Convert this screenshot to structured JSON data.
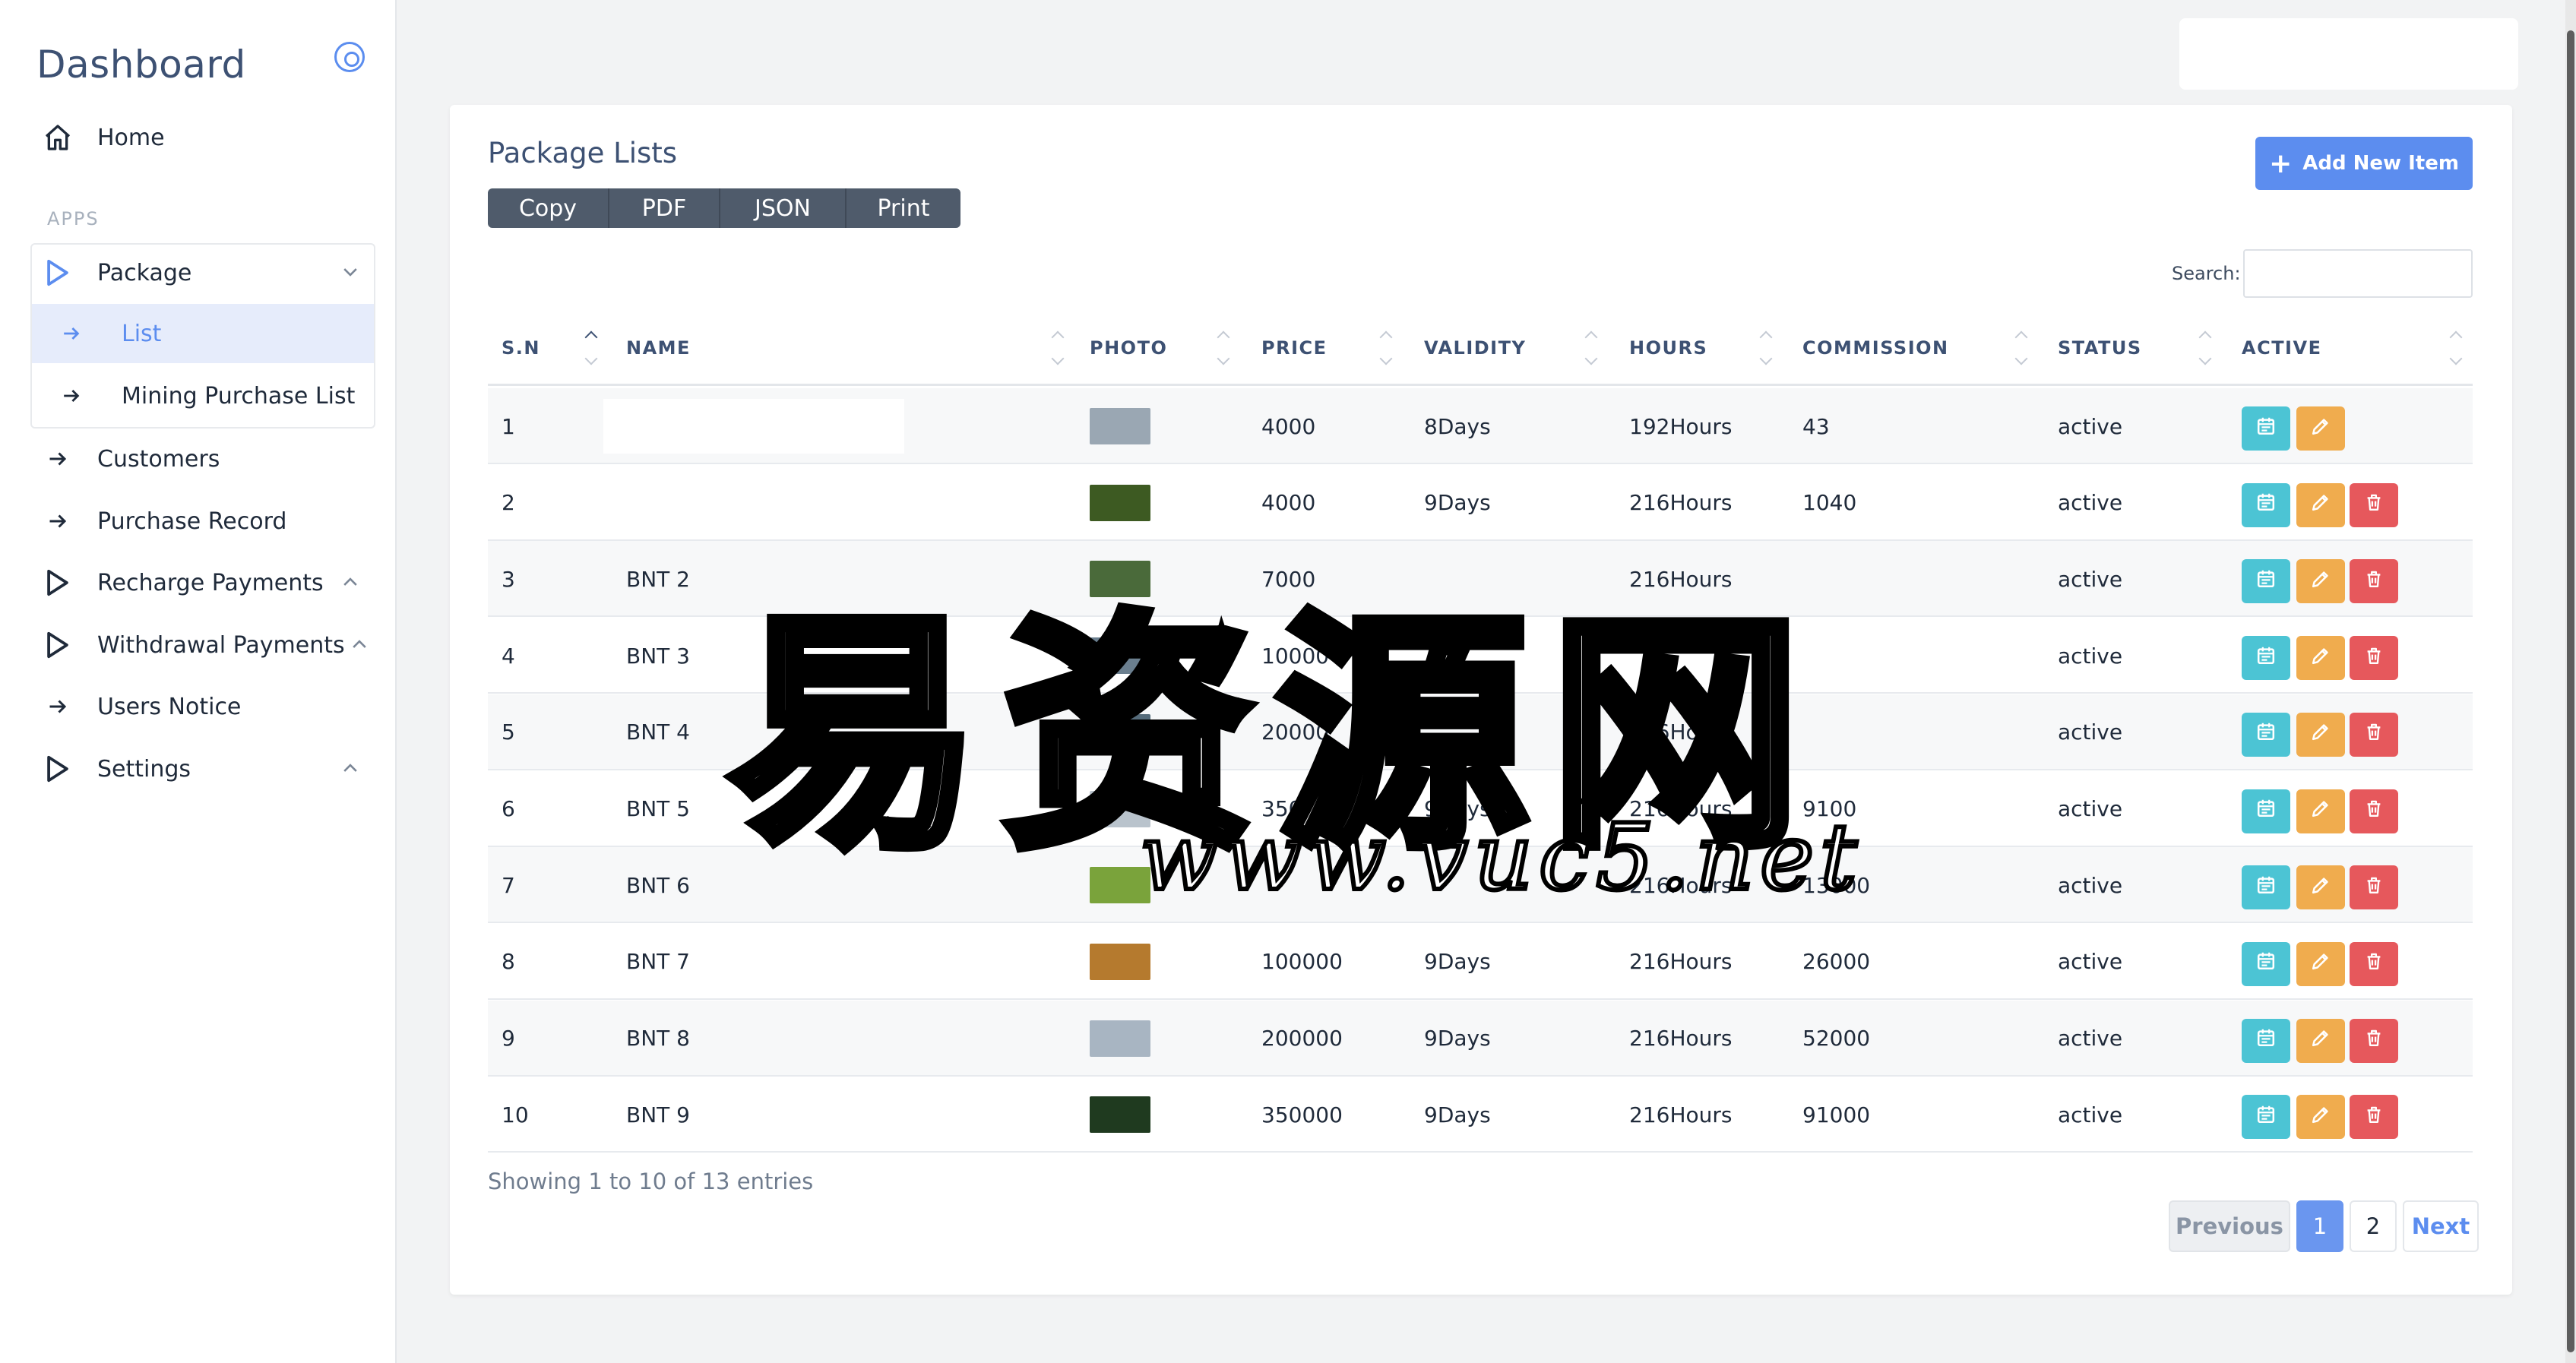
{
  "sidebar": {
    "brand": "Dashboard",
    "section_label": "APPS",
    "home": "Home",
    "package": "Package",
    "package_sub": [
      "List",
      "Mining Purchase List"
    ],
    "items": [
      "Customers",
      "Purchase Record",
      "Recharge Payments",
      "Withdrawal Payments",
      "Users Notice",
      "Settings"
    ]
  },
  "card": {
    "title": "Package Lists",
    "add_button": "Add New Item",
    "export_buttons": [
      "Copy",
      "PDF",
      "JSON",
      "Print"
    ],
    "search_label": "Search:",
    "search_value": ""
  },
  "table": {
    "headers": [
      "S.N",
      "NAME",
      "PHOTO",
      "PRICE",
      "VALIDITY",
      "HOURS",
      "COMMISSION",
      "STATUS",
      "ACTIVE"
    ],
    "rows": [
      {
        "sn": "1",
        "name": "",
        "price": "4000",
        "validity": "8Days",
        "hours": "192Hours",
        "commission": "43",
        "status": "active",
        "photo_color": "#9aa7b3",
        "has_delete": false
      },
      {
        "sn": "2",
        "name": "",
        "price": "4000",
        "validity": "9Days",
        "hours": "216Hours",
        "commission": "1040",
        "status": "active",
        "photo_color": "#3d5a22",
        "has_delete": true
      },
      {
        "sn": "3",
        "name": "BNT 2",
        "price": "7000",
        "validity": "",
        "hours": "216Hours",
        "commission": "",
        "status": "active",
        "photo_color": "#4a6a3a",
        "has_delete": true
      },
      {
        "sn": "4",
        "name": "BNT 3",
        "price": "10000",
        "validity": "",
        "hours": "",
        "commission": "",
        "status": "active",
        "photo_color": "#6b7f8f",
        "has_delete": true
      },
      {
        "sn": "5",
        "name": "BNT 4",
        "price": "20000",
        "validity": "",
        "hours": "216Hours",
        "commission": "",
        "status": "active",
        "photo_color": "#556b7a",
        "has_delete": true
      },
      {
        "sn": "6",
        "name": "BNT 5",
        "price": "35000",
        "validity": "9Days",
        "hours": "216Hours",
        "commission": "9100",
        "status": "active",
        "photo_color": "#b9c3cc",
        "has_delete": true
      },
      {
        "sn": "7",
        "name": "BNT 6",
        "price": "",
        "validity": "",
        "hours": "216Hours",
        "commission": "13000",
        "status": "active",
        "photo_color": "#7aa33b",
        "has_delete": true
      },
      {
        "sn": "8",
        "name": "BNT 7",
        "price": "100000",
        "validity": "9Days",
        "hours": "216Hours",
        "commission": "26000",
        "status": "active",
        "photo_color": "#b57a2e",
        "has_delete": true
      },
      {
        "sn": "9",
        "name": "BNT 8",
        "price": "200000",
        "validity": "9Days",
        "hours": "216Hours",
        "commission": "52000",
        "status": "active",
        "photo_color": "#a8b5c2",
        "has_delete": true
      },
      {
        "sn": "10",
        "name": "BNT 9",
        "price": "350000",
        "validity": "9Days",
        "hours": "216Hours",
        "commission": "91000",
        "status": "active",
        "photo_color": "#1f3a1f",
        "has_delete": true
      }
    ]
  },
  "footer": {
    "info": "Showing 1 to 10 of 13 entries",
    "prev": "Previous",
    "pages": [
      "1",
      "2"
    ],
    "next": "Next"
  },
  "watermark": {
    "cn": "易资源网",
    "url": "www.vuc5.net"
  },
  "colors": {
    "accent": "#5c8def",
    "calendar_btn": "#4cc4d4",
    "edit_btn": "#f0ac4e",
    "delete_btn": "#e6585c"
  }
}
